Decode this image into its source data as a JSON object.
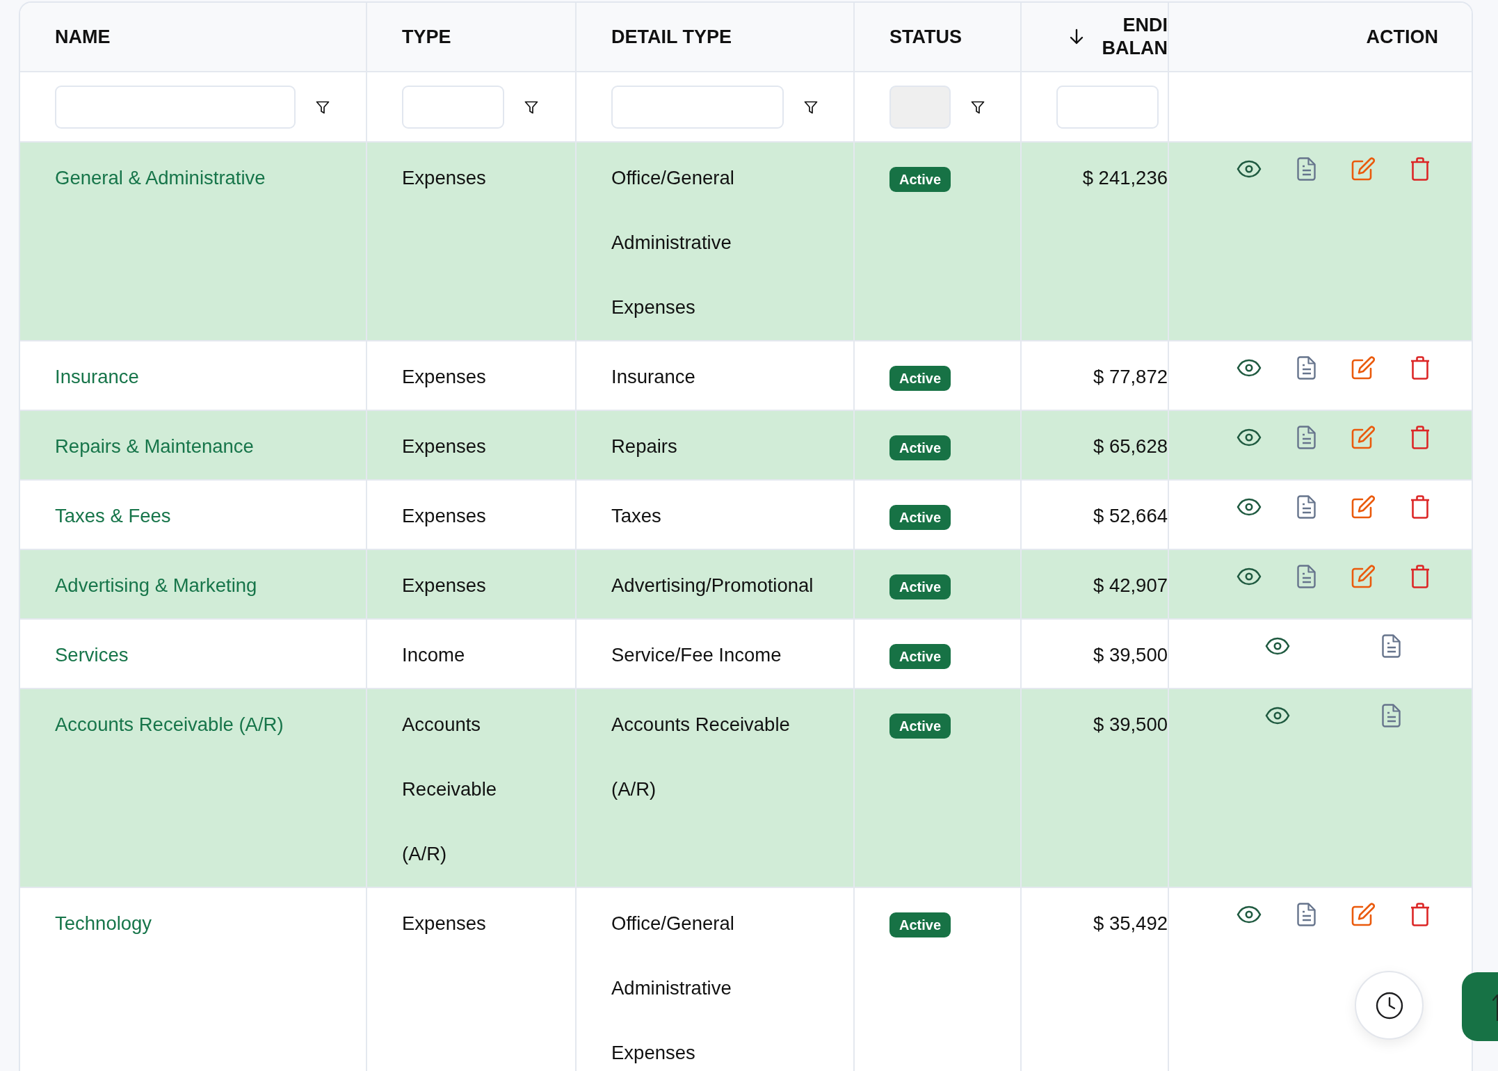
{
  "table": {
    "columns": [
      {
        "label": "NAME",
        "sorted": false,
        "filter": {
          "disabled": false,
          "filter_button": true
        }
      },
      {
        "label": "TYPE",
        "sorted": false,
        "filter": {
          "disabled": false,
          "filter_button": true
        }
      },
      {
        "label": "DETAIL TYPE",
        "sorted": false,
        "filter": {
          "disabled": false,
          "filter_button": true
        }
      },
      {
        "label": "STATUS",
        "sorted": false,
        "filter": {
          "disabled": true,
          "filter_button": true
        }
      },
      {
        "label": "ENDI BALAN",
        "sorted": true,
        "filter": {
          "disabled": false,
          "filter_button": false
        }
      },
      {
        "label": "ACTION",
        "sorted": false
      }
    ],
    "rows": [
      {
        "name": "General & Administrative",
        "type": "Expenses",
        "detail_type": "Office/General Administrative Expenses",
        "status": "Active",
        "ending_balance": "$ 241,236",
        "actions": [
          {
            "kind": "view"
          },
          {
            "kind": "document"
          },
          {
            "kind": "edit"
          },
          {
            "kind": "delete"
          }
        ]
      },
      {
        "name": "Insurance",
        "type": "Expenses",
        "detail_type": "Insurance",
        "status": "Active",
        "ending_balance": "$ 77,872",
        "actions": [
          {
            "kind": "view"
          },
          {
            "kind": "document"
          },
          {
            "kind": "edit"
          },
          {
            "kind": "delete"
          }
        ]
      },
      {
        "name": "Repairs & Maintenance",
        "type": "Expenses",
        "detail_type": "Repairs",
        "status": "Active",
        "ending_balance": "$ 65,628",
        "actions": [
          {
            "kind": "view"
          },
          {
            "kind": "document"
          },
          {
            "kind": "edit"
          },
          {
            "kind": "delete"
          }
        ]
      },
      {
        "name": "Taxes & Fees",
        "type": "Expenses",
        "detail_type": "Taxes",
        "status": "Active",
        "ending_balance": "$ 52,664",
        "actions": [
          {
            "kind": "view"
          },
          {
            "kind": "document"
          },
          {
            "kind": "edit"
          },
          {
            "kind": "delete"
          }
        ]
      },
      {
        "name": "Advertising & Marketing",
        "type": "Expenses",
        "detail_type": "Advertising/Promotional",
        "status": "Active",
        "ending_balance": "$ 42,907",
        "actions": [
          {
            "kind": "view"
          },
          {
            "kind": "document"
          },
          {
            "kind": "edit"
          },
          {
            "kind": "delete"
          }
        ]
      },
      {
        "name": "Services",
        "type": "Income",
        "detail_type": "Service/Fee Income",
        "status": "Active",
        "ending_balance": "$ 39,500",
        "actions": [
          {
            "kind": "view"
          },
          {
            "kind": "document"
          }
        ]
      },
      {
        "name": "Accounts Receivable (A/R)",
        "type": "Accounts Receivable (A/R)",
        "detail_type": "Accounts Receivable (A/R)",
        "status": "Active",
        "ending_balance": "$ 39,500",
        "actions": [
          {
            "kind": "view"
          },
          {
            "kind": "document"
          }
        ]
      },
      {
        "name": "Technology",
        "type": "Expenses",
        "detail_type": "Office/General Administrative Expenses",
        "status": "Active",
        "ending_balance": "$ 35,492",
        "actions": [
          {
            "kind": "view"
          },
          {
            "kind": "document"
          },
          {
            "kind": "edit"
          },
          {
            "kind": "delete"
          }
        ]
      }
    ]
  }
}
